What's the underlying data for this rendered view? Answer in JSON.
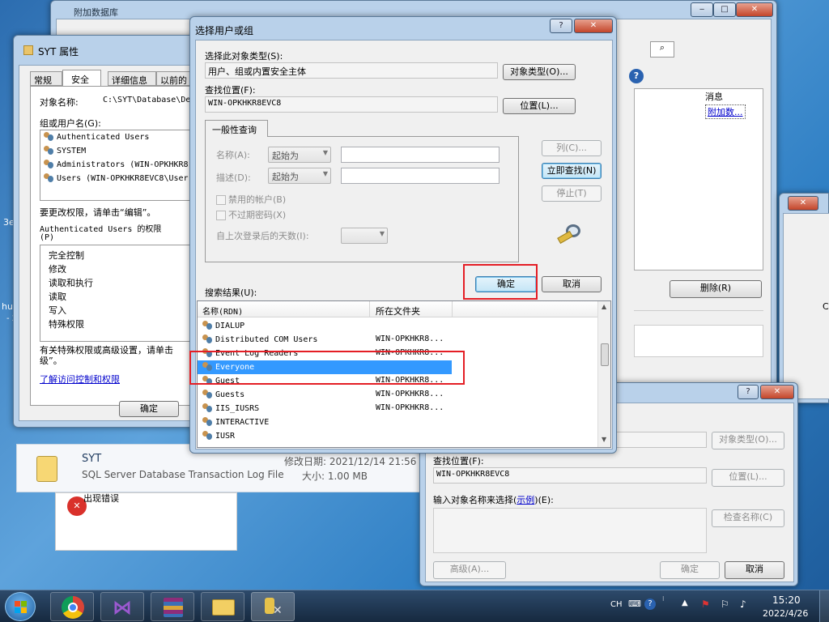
{
  "bg_window": {
    "title": "附加数据库",
    "titlebar_buttons": [
      "‒",
      "□",
      "✕"
    ],
    "col_header": "消息",
    "link": "附加数...",
    "remove_button": "删除(R)"
  },
  "explorer": {
    "file_name": "SYT",
    "file_type": "SQL Server Database Transaction Log File",
    "modified_label": "修改日期: 2021/12/14 21:56",
    "size_label": "大小: 1.00 MB",
    "error_text": "出现错误"
  },
  "left_edge": {
    "text1": "3e",
    "text2": "hu",
    "text3": "- 2"
  },
  "right_edge": {
    "char": "C"
  },
  "props": {
    "title": "SYT 属性",
    "tabs": [
      "常规",
      "安全",
      "详细信息",
      "以前的"
    ],
    "object_label": "对象名称:",
    "object_value": "C:\\SYT\\Database\\De",
    "group_label": "组或用户名(G):",
    "users": [
      "Authenticated Users",
      "SYSTEM",
      "Administrators (WIN-OPKHKR8",
      "Users (WIN-OPKHKR8EVC8\\User"
    ],
    "change_hint": "要更改权限，请单击“编辑”。",
    "perm_label_1": "Authenticated Users 的权限",
    "perm_label_2": "(P)",
    "perms": [
      "完全控制",
      "修改",
      "读取和执行",
      "读取",
      "写入",
      "特殊权限"
    ],
    "special_hint_1": "有关特殊权限或高级设置，请单击",
    "special_hint_2": "级”。",
    "learn_link": "了解访问控制和权限",
    "ok_button": "确定"
  },
  "dialog": {
    "title": "选择用户或组",
    "help_button": "?",
    "close_button": "✕",
    "obj_type_label": "选择此对象类型(S):",
    "obj_type_value": "用户、组或内置安全主体",
    "obj_type_button": "对象类型(O)...",
    "location_label": "查找位置(F):",
    "location_value": "WIN-OPKHKR8EVC8",
    "location_button": "位置(L)...",
    "tab_general": "一般性查询",
    "name_label": "名称(A):",
    "desc_label": "描述(D):",
    "combo_value": "起始为",
    "disabled_accounts": "禁用的帐户(B)",
    "nonexpiring_pwd": "不过期密码(X)",
    "days_label": "自上次登录后的天数(I):",
    "columns_button": "列(C)...",
    "find_now_button": "立即查找(N)",
    "stop_button": "停止(T)",
    "ok_button": "确定",
    "cancel_button": "取消",
    "results_label": "搜索结果(U):",
    "col_name": "名称(RDN)",
    "col_folder": "所在文件夹",
    "results": [
      {
        "name": "DIALUP",
        "folder": ""
      },
      {
        "name": "Distributed COM Users",
        "folder": "WIN-OPKHKR8..."
      },
      {
        "name": "Event Log Readers",
        "folder": "WIN-OPKHKR8..."
      },
      {
        "name": "Everyone",
        "folder": ""
      },
      {
        "name": "Guest",
        "folder": "WIN-OPKHKR8..."
      },
      {
        "name": "Guests",
        "folder": "WIN-OPKHKR8..."
      },
      {
        "name": "IIS_IUSRS",
        "folder": "WIN-OPKHKR8..."
      },
      {
        "name": "INTERACTIVE",
        "folder": ""
      },
      {
        "name": "IUSR",
        "folder": ""
      }
    ],
    "selected_result": "Everyone"
  },
  "dialog2": {
    "help_button": "?",
    "close_button": "✕",
    "obj_type_button": "对象类型(O)...",
    "location_label": "查找位置(F):",
    "location_value": "WIN-OPKHKR8EVC8",
    "location_button": "位置(L)...",
    "enter_label_pre": "输入对象名称来选择(",
    "enter_label_link": "示例",
    "enter_label_post": ")(E):",
    "check_button": "检查名称(C)",
    "advanced_button": "高级(A)...",
    "ok_button": "确定",
    "cancel_button": "取消"
  },
  "taskbar": {
    "lang": "CH",
    "time": "15:20",
    "date": "2022/4/26"
  },
  "colors": {
    "selection": "#3399ff",
    "highlight_box": "#e41e25",
    "link": "#0000cc"
  }
}
